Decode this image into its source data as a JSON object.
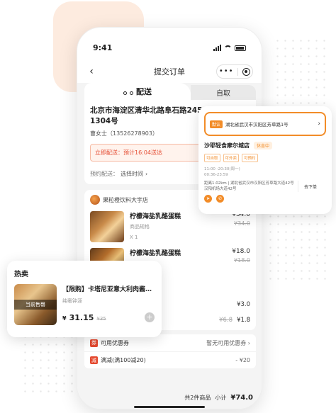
{
  "status_bar": {
    "time": "9:41"
  },
  "nav": {
    "title": "提交订单",
    "back_icon": "‹",
    "more_icon": "•••"
  },
  "tabs": {
    "delivery": "配送",
    "pickup": "自取"
  },
  "address": {
    "line1": "北京市海淀区清华北路阜石路245",
    "line2": "1304号",
    "contact": "曹女士（13526278903）"
  },
  "delivery_option": {
    "label": "立即配送：预计16:04送达"
  },
  "schedule_option": {
    "label": "预约配送：",
    "value": "选择时间",
    "chevron": "›"
  },
  "shop": {
    "name": "果粒橙饮料大宇店",
    "items": [
      {
        "name": "柠檬海盐乳酪蛋糕",
        "sub": "商品规格",
        "qty": "X 1",
        "price": "¥34.0",
        "old_price": "¥34.0"
      },
      {
        "name": "柠檬海盐乳酪蛋糕",
        "price": "¥18.0",
        "old_price": "¥18.0"
      }
    ],
    "fee1": "¥3.0",
    "fee2_old": "¥6.8",
    "fee2_new": "¥1.8"
  },
  "coupon": {
    "icon": "券",
    "label": "可用优惠券",
    "value": "暂无可用优惠券",
    "chevron": "›"
  },
  "discount": {
    "icon": "减",
    "label": "满减(满100减20)",
    "value": "- ¥20"
  },
  "total": {
    "count": "共2件商品",
    "label": "小计",
    "amount": "¥74.0"
  },
  "store_card": {
    "tag": "默认",
    "address": "湖北省武汉市汉阳区芳草路1号",
    "chevron": "›",
    "store_name": "沙耶轻食摩尔城店",
    "status": "休息中",
    "tags": [
      "可自取",
      "可外卖",
      "可预约"
    ],
    "hours": [
      "11:00 -20:30(周一)",
      "00:36-23:59"
    ],
    "distance": "距离1.02km | 湖北省武汉市汉阳区芳草路大道42号汉阳机场大道42号",
    "order_label": "去下单"
  },
  "hot_card": {
    "title": "热卖",
    "sold_out": "当前售罄",
    "name": "【限购】卡塔尼亚意大利肉酱…",
    "sub": "纯奢钟涯",
    "currency": "¥",
    "price": "31.15",
    "old_price": "¥35",
    "add_icon": "+"
  },
  "colors": {
    "accent": "#f28c28",
    "warn": "#e4492f"
  }
}
